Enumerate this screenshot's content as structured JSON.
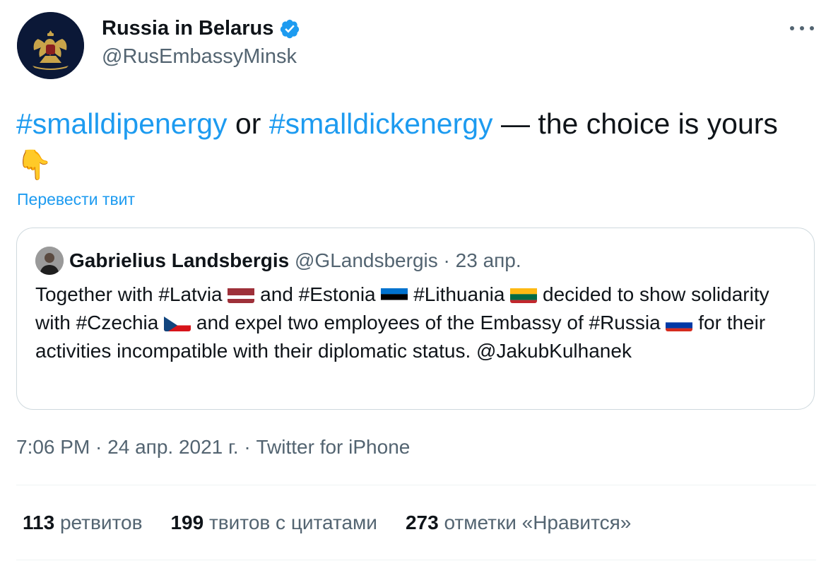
{
  "author": {
    "name": "Russia in Belarus",
    "handle": "@RusEmbassyMinsk",
    "verified_icon": "verified-badge-icon",
    "avatar_icon": "double-headed-eagle-emblem"
  },
  "tweet": {
    "hashtag_1": "#smalldipenergy",
    "connector": " or ",
    "hashtag_2": "#smalldickenergy",
    "rest": " — the choice is yours ",
    "emoji": "👇",
    "translate_label": "Перевести твит"
  },
  "quoted": {
    "name": "Gabrielius Landsbergis",
    "handle": "@GLandsbergis",
    "separator": " · ",
    "date": "23 апр.",
    "body": {
      "t1": "Together with #Latvia ",
      "t2": " and #Estonia ",
      "t3": " #Lithuania ",
      "t4": " decided to show solidarity with #Czechia ",
      "t5": " and expel two employees of the Embassy of #Russia ",
      "t6": " for their activities incompatible with their diplomatic status. @JakubKulhanek"
    },
    "flags": [
      "latvia-flag-icon",
      "estonia-flag-icon",
      "lithuania-flag-icon",
      "czechia-flag-icon",
      "russia-flag-icon"
    ]
  },
  "meta": {
    "timestamp": "7:06 PM · 24 апр. 2021 г. · Twitter for iPhone"
  },
  "stats": {
    "retweets_count": "113",
    "retweets_label": "ретвитов",
    "quotes_count": "199",
    "quotes_label": "твитов с цитатами",
    "likes_count": "273",
    "likes_label": "отметки «Нравится»"
  },
  "colors": {
    "accent": "#1d9bf0",
    "text": "#0f1419",
    "secondary": "#536471",
    "border": "#cfd9de"
  }
}
